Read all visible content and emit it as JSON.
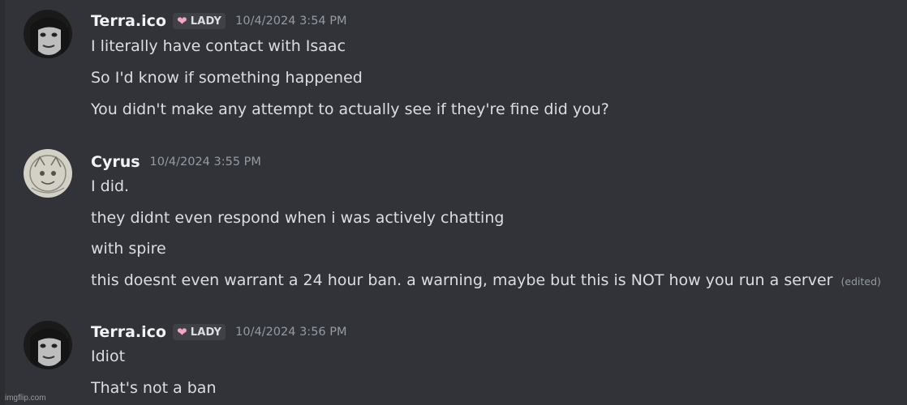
{
  "messages": [
    {
      "username": "Terra.ico",
      "tag": "LADY",
      "timestamp": "10/4/2024 3:54 PM",
      "lines": [
        "I literally have contact with Isaac",
        "So I'd know if something happened",
        "You didn't make any attempt to actually see if they're fine did you?"
      ]
    },
    {
      "username": "Cyrus",
      "timestamp": "10/4/2024 3:55 PM",
      "lines": [
        "I did.",
        "they didnt even respond when i was actively chatting",
        "with spire",
        "this doesnt even warrant a 24 hour ban. a warning, maybe but this is NOT how you run a server"
      ],
      "edited_label": "(edited)"
    },
    {
      "username": "Terra.ico",
      "tag": "LADY",
      "timestamp": "10/4/2024 3:56 PM",
      "lines": [
        "Idiot",
        "That's not a ban"
      ]
    }
  ],
  "watermark": "imgflip.com",
  "colors": {
    "background": "#313338",
    "text": "#dbdee1",
    "username": "#f2f3f5",
    "timestamp": "#949ba4",
    "tag_bg": "#3f4147",
    "heart": "#f4a6c7"
  },
  "icons": {
    "tag_icon": "heart-icon"
  }
}
